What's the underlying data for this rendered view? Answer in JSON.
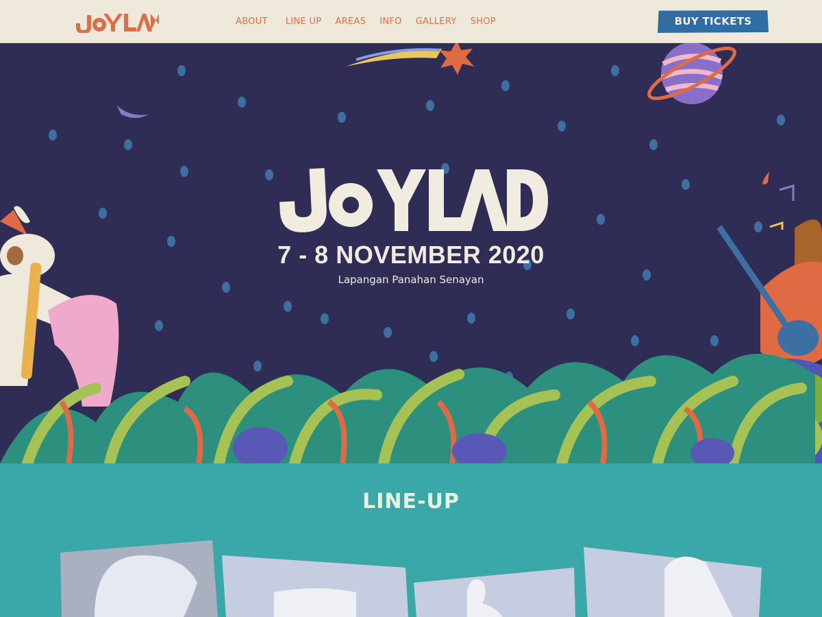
{
  "nav": {
    "logo_text": "JOYLAND",
    "items": [
      "ABOUT",
      "LINE UP",
      "AREAS",
      "INFO",
      "GALLERY",
      "SHOP"
    ],
    "buy_label": "BUY TICKETS"
  },
  "hero": {
    "title": "JOYLAND",
    "date": "7 - 8 NOVEMBER 2020",
    "venue": "Lapangan Panahan Senayan"
  },
  "lineup": {
    "title": "LINE-UP"
  },
  "colors": {
    "nav_bg": "#efe9dc",
    "accent": "#d86f4a",
    "button": "#2f6da3",
    "hero_bg": "#2f2d56",
    "lineup_bg": "#3aa8a8"
  }
}
